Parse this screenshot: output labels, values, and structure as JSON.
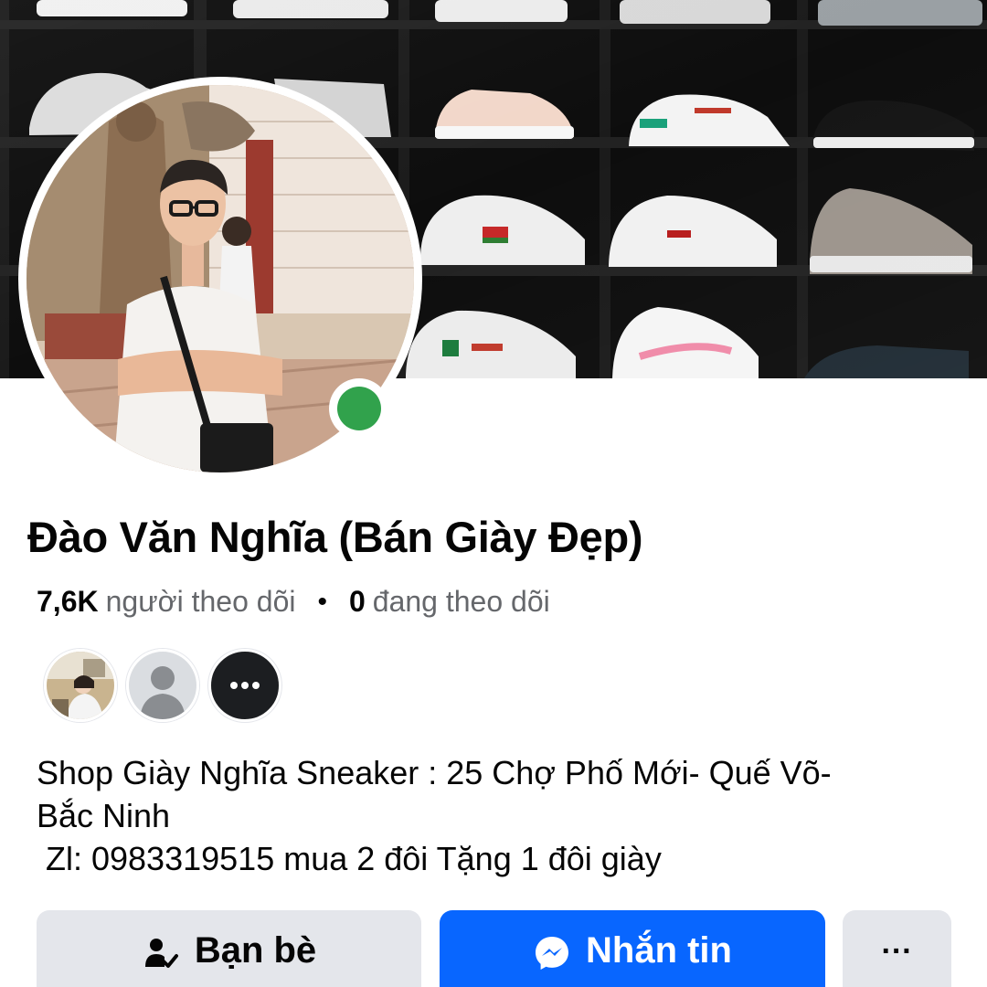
{
  "profile": {
    "name": "Đào Văn Nghĩa (Bán Giày Đẹp)",
    "online": true,
    "cover_photo": "sneaker-shelves-photo",
    "avatar_photo": "man-white-tshirt-photo"
  },
  "stats": {
    "followers_count": "7,6K",
    "followers_label": "người theo dõi",
    "separator": "•",
    "following_count": "0",
    "following_label": "đang theo dõi"
  },
  "friends_preview": [
    {
      "icon": "friend-photo"
    },
    {
      "icon": "default-user-icon"
    },
    {
      "icon": "more-dots-icon"
    }
  ],
  "bio": {
    "line1": "Shop Giày Nghĩa Sneaker : 25 Chợ Phố Mới- Quế Võ-",
    "line2": "Bắc Ninh",
    "line3": " Zl: 0983319515 mua 2 đôi Tặng 1 đôi giày"
  },
  "actions": {
    "friends_label": "Bạn bè",
    "message_label": "Nhắn tin",
    "more_label": "···"
  },
  "colors": {
    "online_green": "#31a24c",
    "messenger_blue": "#0866ff",
    "button_gray": "#e4e6eb",
    "secondary_text": "#65676b"
  }
}
